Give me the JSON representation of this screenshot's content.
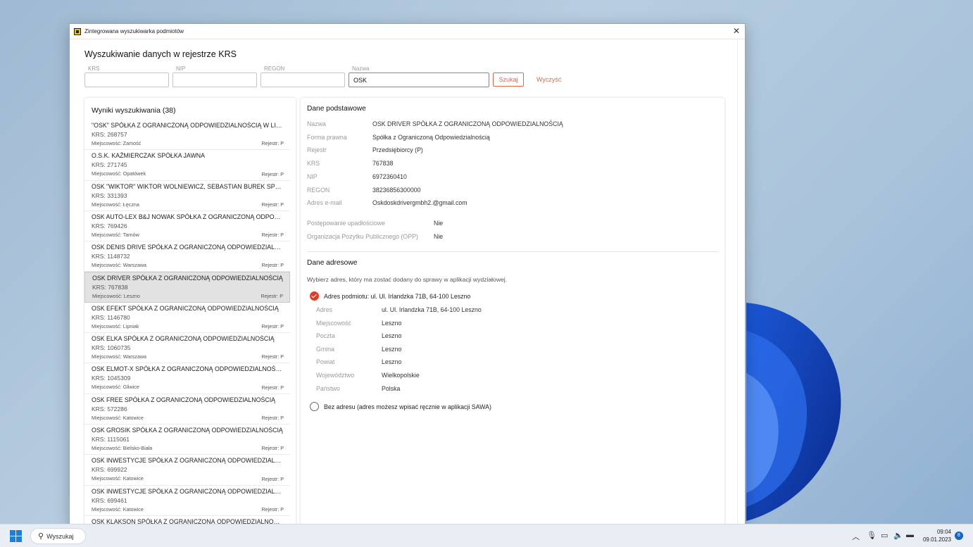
{
  "window": {
    "title": "Zintegrowana wyszukiwarka podmiotów",
    "close_glyph": "✕"
  },
  "page": {
    "heading": "Wyszukiwanie danych w rejestrze KRS"
  },
  "search": {
    "fields": [
      {
        "label": "KRS",
        "value": ""
      },
      {
        "label": "NIP",
        "value": ""
      },
      {
        "label": "REGON",
        "value": ""
      },
      {
        "label": "Nazwa",
        "value": "OSK"
      }
    ],
    "search_button": "Szukaj",
    "clear_button": "Wyczyść"
  },
  "results": {
    "title": "Wyniki wyszukiwania (38)",
    "items": [
      {
        "name": "\"OSK\" SPÓŁKA Z OGRANICZONĄ ODPOWIEDZIALNOŚCIĄ W LIKWIDACJI",
        "krs": "KRS: 268757",
        "city": "Miejscowość: Zamość",
        "registry": "Rejestr: P"
      },
      {
        "name": "O.S.K. KAŹMIERCZAK SPÓŁKA JAWNA",
        "krs": "KRS: 271745",
        "city": "Miejscowość: Opatówek",
        "registry": "Rejestr: P"
      },
      {
        "name": "OSK \"WIKTOR\" WIKTOR WOLNIEWICZ, SEBASTIAN BUREK SPÓŁKA JAWNA",
        "krs": "KRS: 331393",
        "city": "Miejscowość: Łęczna",
        "registry": "Rejestr: P"
      },
      {
        "name": "OSK AUTO-LEX B&J NOWAK SPÓŁKA Z OGRANICZONĄ ODPOWIEDZIALNOŚCIĄ",
        "krs": "KRS: 769426",
        "city": "Miejscowość: Tarnów",
        "registry": "Rejestr: P"
      },
      {
        "name": "OSK DENIS DRIVE SPÓŁKA Z OGRANICZONĄ ODPOWIEDZIALNOŚCIĄ",
        "krs": "KRS: 1148732",
        "city": "Miejscowość: Warszawa",
        "registry": "Rejestr: P"
      },
      {
        "name": "OSK DRIVER SPÓŁKA Z OGRANICZONĄ ODPOWIEDZIALNOŚCIĄ",
        "krs": "KRS: 767838",
        "city": "Miejscowość: Leszno",
        "registry": "Rejestr: P",
        "selected": true
      },
      {
        "name": "OSK EFEKT SPÓŁKA Z OGRANICZONĄ ODPOWIEDZIALNOŚCIĄ",
        "krs": "KRS: 1146780",
        "city": "Miejscowość: Lipniak",
        "registry": "Rejestr: P"
      },
      {
        "name": "OSK ELKA SPÓŁKA Z OGRANICZONĄ ODPOWIEDZIALNOŚCIĄ",
        "krs": "KRS: 1060735",
        "city": "Miejscowość: Warszawa",
        "registry": "Rejestr: P"
      },
      {
        "name": "OSK ELMOT-X SPÓŁKA Z OGRANICZONĄ ODPOWIEDZIALNOŚCIĄ",
        "krs": "KRS: 1045309",
        "city": "Miejscowość: Gliwice",
        "registry": "Rejestr: P"
      },
      {
        "name": "OSK FREE SPÓŁKA Z OGRANICZONĄ ODPOWIEDZIALNOŚCIĄ",
        "krs": "KRS: 572286",
        "city": "Miejscowość: Katowice",
        "registry": "Rejestr: P"
      },
      {
        "name": "OSK GROSIK SPÓŁKA Z OGRANICZONĄ ODPOWIEDZIALNOŚCIĄ",
        "krs": "KRS: 1115061",
        "city": "Miejscowość: Bielsko-Biała",
        "registry": "Rejestr: P"
      },
      {
        "name": "OSK INWESTYCJE SPÓŁKA Z OGRANICZONĄ ODPOWIEDZIALNOŚCIĄ",
        "krs": "KRS: 699922",
        "city": "Miejscowość: Katowice",
        "registry": "Rejestr: P"
      },
      {
        "name": "OSK INWESTYCJE SPÓŁKA Z OGRANICZONĄ ODPOWIEDZIALNOŚCIĄ",
        "krs": "KRS: 699461",
        "city": "Miejscowość: Katowice",
        "registry": "Rejestr: P"
      },
      {
        "name": "OSK KLAKSON SPÓŁKA Z OGRANICZONĄ ODPOWIEDZIALNOŚCIĄ",
        "krs": "",
        "city": "",
        "registry": ""
      }
    ]
  },
  "basic": {
    "title": "Dane podstawowe",
    "rows": [
      {
        "label": "Nazwa",
        "value": "OSK DRIVER SPÓŁKA Z OGRANICZONĄ ODPOWIEDZIALNOŚCIĄ"
      },
      {
        "label": "Forma prawna",
        "value": "Spółka z Ograniczoną Odpowiedzialnością"
      },
      {
        "label": "Rejestr",
        "value": "Przedsiębiorcy (P)"
      },
      {
        "label": "KRS",
        "value": "767838"
      },
      {
        "label": "NIP",
        "value": "6972360410"
      },
      {
        "label": "REGON",
        "value": "38236856300000"
      },
      {
        "label": "Adres e-mail",
        "value": "Oskdoskdrivergmbh2.@gmail.com"
      }
    ],
    "extra": [
      {
        "label": "Postępowanie upadłościowe",
        "value": "Nie"
      },
      {
        "label": "Organizacja Pożytku Publicznego (OPP)",
        "value": "Nie"
      }
    ]
  },
  "address": {
    "title": "Dane adresowe",
    "hint": "Wybierz adres, który ma zostać dodany do sprawy w aplikacji wydziałowej.",
    "option_selected": "Adres podmiotu: ul. Ul. Irlandzka 71B, 64-100 Leszno",
    "rows": [
      {
        "label": "Adres",
        "value": "ul. Ul. Irlandzka 71B, 64-100 Leszno"
      },
      {
        "label": "Miejscowość",
        "value": "Leszno"
      },
      {
        "label": "Poczta",
        "value": "Leszno"
      },
      {
        "label": "Gmina",
        "value": "Leszno"
      },
      {
        "label": "Powiat",
        "value": "Leszno"
      },
      {
        "label": "Województwo",
        "value": "Wielkopolskie"
      },
      {
        "label": "Państwo",
        "value": "Polska"
      }
    ],
    "option_none": "Bez adresu (adres możesz wpisać ręcznie w aplikacji SAWA)"
  },
  "taskbar": {
    "search_label": "Wyszukaj",
    "time": "09:04",
    "date": "09.01.2023",
    "notifications": "8",
    "accent": "#1b7fd8"
  }
}
